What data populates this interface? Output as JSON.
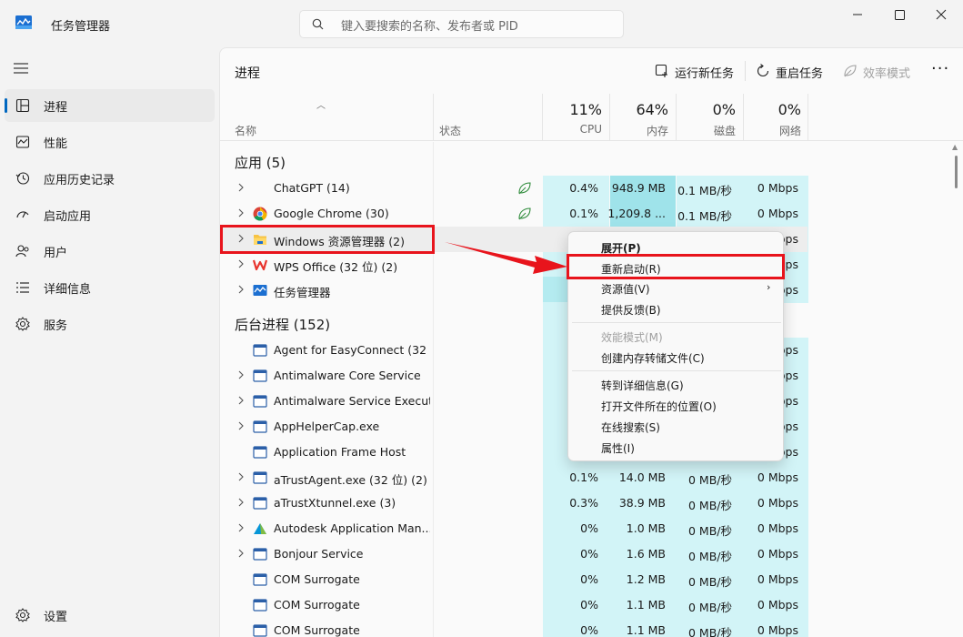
{
  "window": {
    "title": "任务管理器"
  },
  "search": {
    "placeholder": "键入要搜索的名称、发布者或 PID"
  },
  "sidebar": {
    "items": [
      {
        "label": "进程"
      },
      {
        "label": "性能"
      },
      {
        "label": "应用历史记录"
      },
      {
        "label": "启动应用"
      },
      {
        "label": "用户"
      },
      {
        "label": "详细信息"
      },
      {
        "label": "服务"
      }
    ],
    "settings_label": "设置"
  },
  "main": {
    "title": "进程",
    "toolbar": {
      "run_new_task": "运行新任务",
      "restart_task": "重启任务",
      "efficiency_mode": "效率模式",
      "more": "···"
    },
    "columns": {
      "name": "名称",
      "status": "状态",
      "cpu_pct": "11%",
      "cpu": "CPU",
      "mem_pct": "64%",
      "mem": "内存",
      "disk_pct": "0%",
      "disk": "磁盘",
      "net_pct": "0%",
      "net": "网络"
    },
    "groups": {
      "apps": "应用 (5)",
      "background": "后台进程 (152)"
    },
    "apps": [
      {
        "name": "ChatGPT (14)",
        "cpu": "0.4%",
        "mem": "948.9 MB",
        "disk": "0.1 MB/秒",
        "net": "0 Mbps"
      },
      {
        "name": "Google Chrome (30)",
        "cpu": "0.1%",
        "mem": "1,209.8 ...",
        "disk": "0.1 MB/秒",
        "net": "0 Mbps"
      },
      {
        "name": "Windows 资源管理器 (2)",
        "cpu": "",
        "mem": "",
        "disk": "",
        "net": "bps"
      },
      {
        "name": "WPS Office (32 位) (2)",
        "cpu": "",
        "mem": "",
        "disk": "",
        "net": "bps"
      },
      {
        "name": "任务管理器",
        "cpu": "",
        "mem": "",
        "disk": "",
        "net": "bps"
      }
    ],
    "background": [
      {
        "name": "Agent for EasyConnect (32 ...",
        "cpu": "",
        "mem": "",
        "disk": "",
        "net": "bps"
      },
      {
        "name": "Antimalware Core Service",
        "cpu": "",
        "mem": "",
        "disk": "",
        "net": "bps"
      },
      {
        "name": "Antimalware Service Execut...",
        "cpu": "",
        "mem": "",
        "disk": "",
        "net": "bps"
      },
      {
        "name": "AppHelperCap.exe",
        "cpu": "",
        "mem": "",
        "disk": "",
        "net": "bps"
      },
      {
        "name": "Application Frame Host",
        "cpu": "",
        "mem": "",
        "disk": "",
        "net": "bps"
      },
      {
        "name": "aTrustAgent.exe (32 位) (2)",
        "cpu": "0.1%",
        "mem": "14.0 MB",
        "disk": "0 MB/秒",
        "net": "0 Mbps"
      },
      {
        "name": "aTrustXtunnel.exe (3)",
        "cpu": "0.3%",
        "mem": "38.9 MB",
        "disk": "0 MB/秒",
        "net": "0 Mbps"
      },
      {
        "name": "Autodesk Application Man...",
        "cpu": "0%",
        "mem": "1.0 MB",
        "disk": "0 MB/秒",
        "net": "0 Mbps"
      },
      {
        "name": "Bonjour Service",
        "cpu": "0%",
        "mem": "1.6 MB",
        "disk": "0 MB/秒",
        "net": "0 Mbps"
      },
      {
        "name": "COM Surrogate",
        "cpu": "0%",
        "mem": "1.2 MB",
        "disk": "0 MB/秒",
        "net": "0 Mbps"
      },
      {
        "name": "COM Surrogate",
        "cpu": "0%",
        "mem": "1.1 MB",
        "disk": "0 MB/秒",
        "net": "0 Mbps"
      },
      {
        "name": "COM Surrogate",
        "cpu": "0%",
        "mem": "1.1 MB",
        "disk": "0 MB/秒",
        "net": "0 Mbps"
      }
    ]
  },
  "context_menu": {
    "expand": "展开(P)",
    "restart": "重新启动(R)",
    "resource_values": "资源值(V)",
    "feedback": "提供反馈(B)",
    "efficiency": "效能模式(M)",
    "dump": "创建内存转储文件(C)",
    "details": "转到详细信息(G)",
    "open_location": "打开文件所在的位置(O)",
    "search_online": "在线搜索(S)",
    "properties": "属性(I)"
  },
  "colors": {
    "accent": "#0067c0",
    "highlight": "#e8141c",
    "mem_heat": "#9fe3ea",
    "heat_light": "#d2f4f7"
  }
}
